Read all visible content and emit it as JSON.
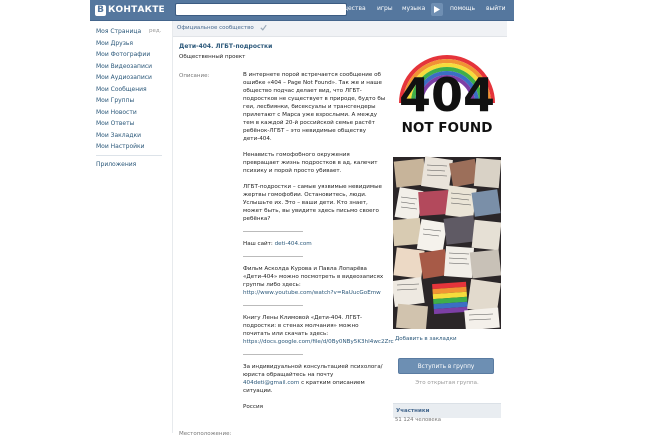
{
  "header": {
    "logo_glyph": "В",
    "logo_text": "КОНТАКТЕ",
    "nav": [
      "люди",
      "сообщества",
      "игры",
      "музыка",
      "помощь",
      "выйти"
    ],
    "play_icon": "play-icon"
  },
  "sidebar": {
    "items": [
      {
        "label": "Моя Страница"
      },
      {
        "label": "Мои Друзья"
      },
      {
        "label": "Мои Фотографии"
      },
      {
        "label": "Мои Видеозаписи"
      },
      {
        "label": "Мои Аудиозаписи"
      },
      {
        "label": "Мои Сообщения"
      },
      {
        "label": "Мои Группы"
      },
      {
        "label": "Мои Новости"
      },
      {
        "label": "Мои Ответы"
      },
      {
        "label": "Мои Закладки"
      },
      {
        "label": "Мои Настройки"
      }
    ],
    "edit_label": "ред.",
    "apps_label": "Приложения"
  },
  "group": {
    "official_label": "Официальное сообщество",
    "title": "Дети-404. ЛГБТ-подростки",
    "subtitle": "Общественный проект",
    "description_label": "Описание:",
    "members_field_label": "Местоположение:",
    "description": {
      "p1": "В интернете порой встречается сообщение об ошибке «404 – Page Not Found». Так же и наше общество подчас делает вид, что ЛГБТ-подростков не существует в природе, будто бы геи, лесбиянки, бисексуалы и трансгендеры прилетают с Марса уже взрослыми. А между тем в каждой 20-й российской семье растёт ребёнок-ЛГБТ – это невидимые обществу дети-404.",
      "p2": "Ненависть гомофобного окружения превращает жизнь подростков в ад, калечит психику и порой просто убивает.",
      "p3": "ЛГБТ-подростки – самые уязвимые невидимые жертвы гомофобии. Остановитесь, люди. Услышьте их. Это – ваши дети. Кто знает, может быть, вы увидите здесь письмо своего ребёнка?",
      "site_label": "Наш сайт:",
      "site_link": "deti-404.com",
      "p4": "Фильм Асколда Курова и Павла Лопарёва «Дети-404» можно посмотреть в видеозаписях группы либо здесь:",
      "link2": "http://www.youtube.com/watch?v=RaUucGoEmw",
      "p5": "Книгу Лены Климовой «Дети-404. ЛГБТ-подростки: в стенах молчания» можно почитать или скачать здесь:",
      "link3": "https://docs.google.com/file/d/0By0NBy5K3hI4wc2Zrc",
      "p6": "За индивидуальной консультацией психолога/юриста обращайтесь на почту",
      "email": "404deti@gmail.com",
      "p6b": "с кратким описанием ситуации.",
      "p7": "Россия"
    },
    "cover_text_top": "404",
    "cover_text_bottom": "NOT FOUND",
    "bookmark_label": "Добавить в закладки",
    "join_label": "Вступить в группу",
    "open_group_label": "Это открытая группа.",
    "members_title": "Участники",
    "members_count": "51 124 человека"
  },
  "colors": {
    "topbar": "#55779e",
    "link": "#2b587a",
    "button": "#6d8fb3"
  }
}
